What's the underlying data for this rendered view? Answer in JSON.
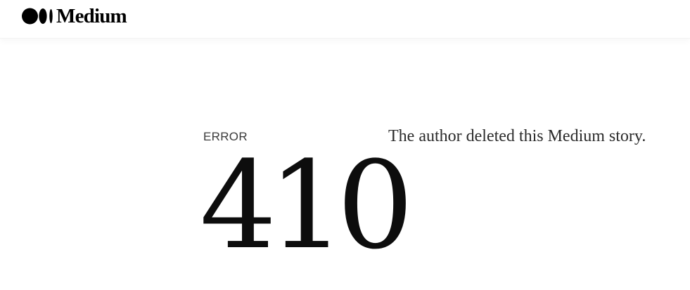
{
  "header": {
    "logo_text": "Medium",
    "logo_icon": "medium-logo-icon"
  },
  "error": {
    "label": "ERROR",
    "code": "410",
    "message": "The author deleted this Medium story."
  },
  "colors": {
    "background": "#ffffff",
    "text": "#0d0d0d",
    "muted_text": "#3a3a3a"
  }
}
